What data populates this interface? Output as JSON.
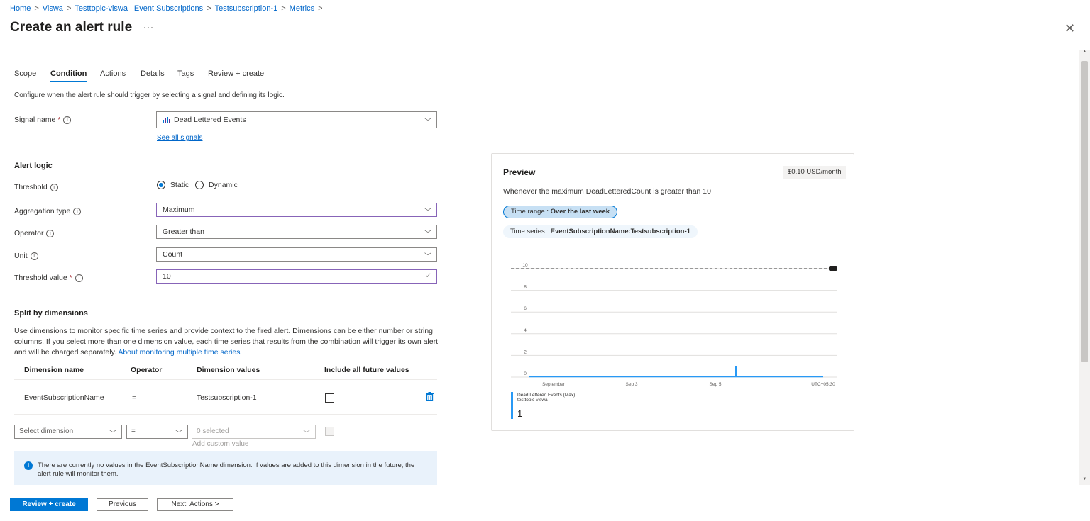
{
  "breadcrumb": [
    "Home",
    "Viswa",
    "Testtopic-viswa | Event Subscriptions",
    "Testsubscription-1",
    "Metrics"
  ],
  "breadcrumb_sep": ">",
  "title": "Create an alert rule",
  "title_more": "···",
  "close": "✕",
  "tabs": [
    "Scope",
    "Condition",
    "Actions",
    "Details",
    "Tags",
    "Review + create"
  ],
  "active_tab": "Condition",
  "description": "Configure when the alert rule should trigger by selecting a signal and defining its logic.",
  "signal": {
    "label": "Signal name",
    "required_mark": "*",
    "value": "Dead Lettered Events",
    "see_all": "See all signals"
  },
  "alert_logic": {
    "heading": "Alert logic",
    "threshold_label": "Threshold",
    "threshold_options": [
      "Static",
      "Dynamic"
    ],
    "threshold_selected": "Static",
    "aggregation_label": "Aggregation type",
    "aggregation_value": "Maximum",
    "operator_label": "Operator",
    "operator_value": "Greater than",
    "unit_label": "Unit",
    "unit_value": "Count",
    "threshold_value_label": "Threshold value",
    "threshold_value": "10"
  },
  "split": {
    "heading": "Split by dimensions",
    "text": "Use dimensions to monitor specific time series and provide context to the fired alert. Dimensions can be either number or string columns. If you select more than one dimension value, each time series that results from the combination will trigger its own alert and will be charged separately.",
    "link": "About monitoring multiple time series",
    "columns": [
      "Dimension name",
      "Operator",
      "Dimension values",
      "Include all future values"
    ],
    "row": {
      "name": "EventSubscriptionName",
      "operator": "=",
      "values": "Testsubscription-1"
    },
    "new_row": {
      "dimension_placeholder": "Select dimension",
      "operator": "=",
      "values": "0 selected",
      "custom_hint": "Add custom value"
    },
    "info": "There are currently no values in the EventSubscriptionName dimension. If values are added to this dimension in the future, the alert rule will monitor them."
  },
  "footer": {
    "review": "Review + create",
    "previous": "Previous",
    "next": "Next: Actions >"
  },
  "preview": {
    "title": "Preview",
    "price": "$0.10 USD/month",
    "description": "Whenever the maximum DeadLetteredCount is greater than 10",
    "time_range_label": "Time range : ",
    "time_range_value": "Over the last week",
    "time_series_label": "Time series : ",
    "time_series_value": "EventSubscriptionName:Testsubscription-1"
  },
  "chart_data": {
    "type": "line",
    "title": "",
    "ylim": [
      0,
      10
    ],
    "yticks": [
      "0",
      "2",
      "4",
      "6",
      "8",
      "10"
    ],
    "xticks": [
      "September",
      "Sep 3",
      "Sep 5",
      "UTC+05:30"
    ],
    "threshold": 10,
    "series": [
      {
        "name": "Dead Lettered Events (Max)",
        "sub": "testtopic-viswa",
        "spike_value": 1,
        "color": "#2899f5"
      }
    ],
    "legend_value": "1",
    "grid": true
  }
}
